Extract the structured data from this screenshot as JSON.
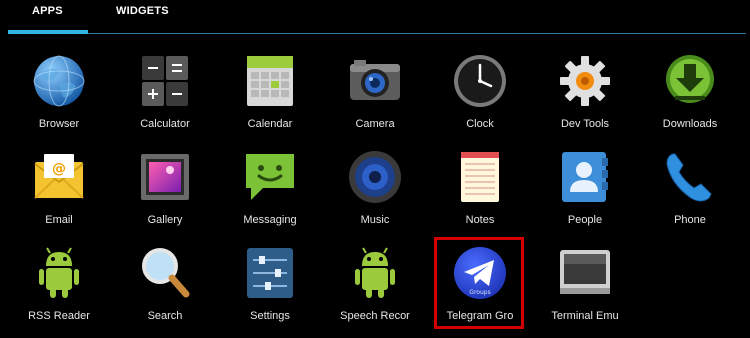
{
  "tabs": [
    {
      "label": "APPS",
      "selected": true
    },
    {
      "label": "WIDGETS",
      "selected": false
    }
  ],
  "accent_color": "#33b5e5",
  "highlight_color": "#d40000",
  "apps": [
    {
      "label": "Browser",
      "icon": "globe-icon"
    },
    {
      "label": "Calculator",
      "icon": "calculator-icon"
    },
    {
      "label": "Calendar",
      "icon": "calendar-icon"
    },
    {
      "label": "Camera",
      "icon": "camera-icon"
    },
    {
      "label": "Clock",
      "icon": "clock-icon"
    },
    {
      "label": "Dev Tools",
      "icon": "gear-icon"
    },
    {
      "label": "Downloads",
      "icon": "download-icon"
    },
    {
      "label": "Email",
      "icon": "envelope-icon"
    },
    {
      "label": "Gallery",
      "icon": "gallery-icon"
    },
    {
      "label": "Messaging",
      "icon": "chat-bubble-icon"
    },
    {
      "label": "Music",
      "icon": "speaker-icon"
    },
    {
      "label": "Notes",
      "icon": "notepad-icon"
    },
    {
      "label": "People",
      "icon": "contacts-icon"
    },
    {
      "label": "Phone",
      "icon": "phone-handset-icon"
    },
    {
      "label": "RSS Reader",
      "icon": "android-robot-icon"
    },
    {
      "label": "Search",
      "icon": "magnifier-icon"
    },
    {
      "label": "Settings",
      "icon": "sliders-icon"
    },
    {
      "label": "Speech Recor",
      "icon": "android-robot-icon"
    },
    {
      "label": "Telegram Gro",
      "icon": "telegram-icon",
      "badge": "Groups",
      "highlighted": true
    },
    {
      "label": "Terminal Emu",
      "icon": "terminal-screen-icon"
    }
  ]
}
